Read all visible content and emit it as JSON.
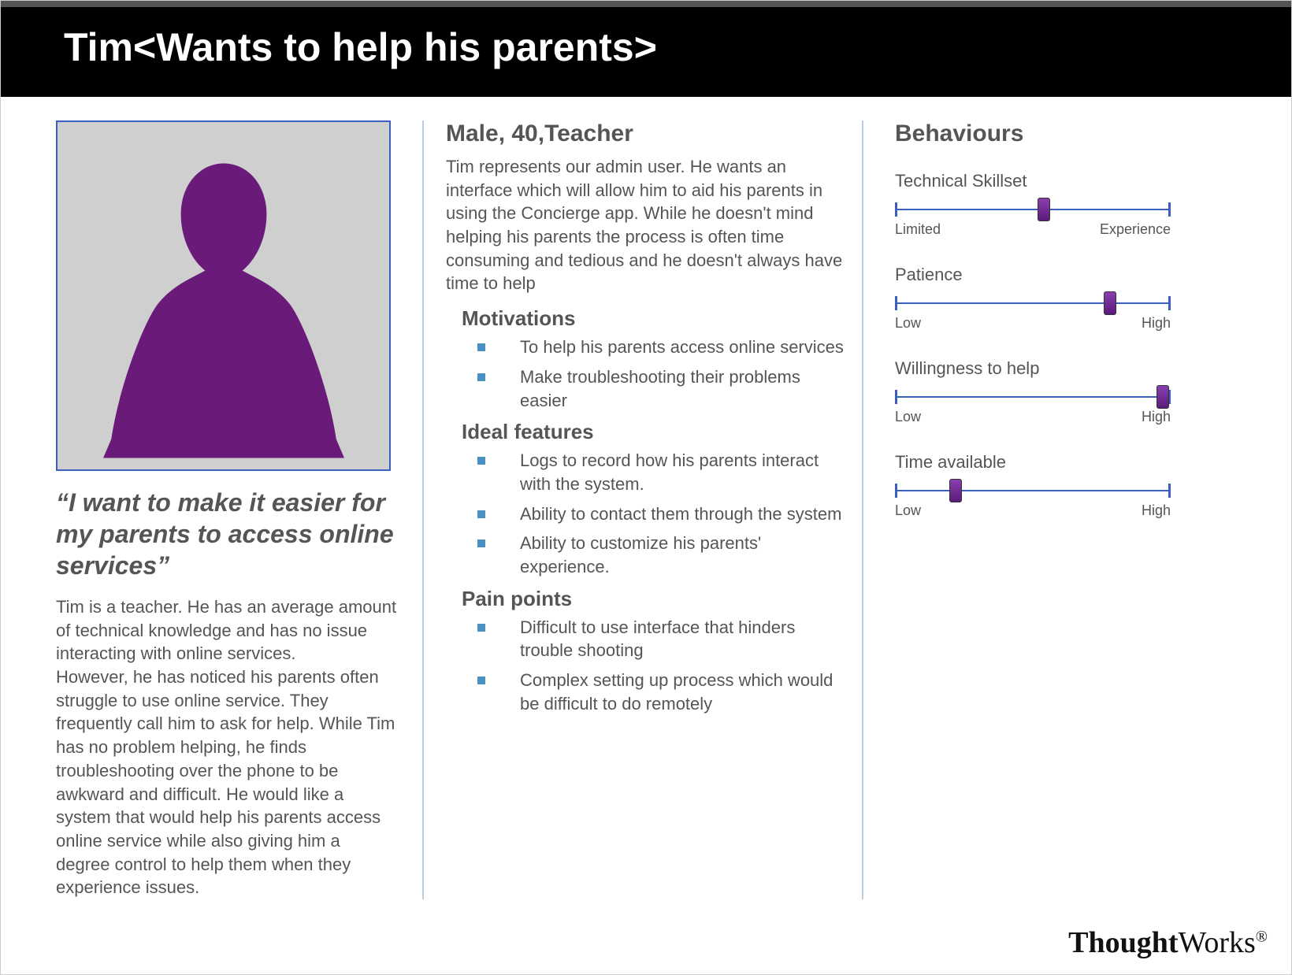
{
  "header": {
    "title": "Tim<Wants to help his parents>"
  },
  "left": {
    "quote": "“I want to make it easier for my parents to access online services”",
    "bio1": "Tim is a teacher. He has an average amount of technical knowledge and has no issue interacting with online services.",
    "bio2": "However, he has noticed his parents often struggle to use online service. They frequently call him to ask for help. While Tim has no problem helping, he finds troubleshooting over the phone to be awkward and difficult. He would like a system that would help his parents access online service while also giving him a degree control to help them when they experience issues."
  },
  "mid": {
    "demographics": "Male, 40,Teacher",
    "description": " Tim represents our admin user. He wants an interface which will allow him to aid his parents in using the Concierge app. While he doesn't mind  helping his parents the process is often time consuming and tedious and he doesn't always have time to help",
    "motivations_h": "Motivations",
    "motivations": [
      "To help his parents access online services",
      "Make troubleshooting their problems easier"
    ],
    "ideal_h": "Ideal features",
    "ideal": [
      "Logs to record how his parents interact with the system.",
      "Ability to contact them through the system",
      "Ability to customize his parents' experience."
    ],
    "pain_h": "Pain points",
    "pain": [
      "Difficult to use interface that hinders trouble shooting",
      "Complex setting up process which would be difficult to do remotely"
    ]
  },
  "right": {
    "title": "Behaviours",
    "scales": [
      {
        "label": "Technical Skillset",
        "low": "Limited",
        "high": "Experience",
        "value": 54
      },
      {
        "label": "Patience",
        "low": "Low",
        "high": "High",
        "value": 78
      },
      {
        "label": "Willingness to help",
        "low": "Low",
        "high": "High",
        "value": 97
      },
      {
        "label": "Time available",
        "low": "Low",
        "high": "High",
        "value": 22
      }
    ]
  },
  "footer": {
    "logo_bold": "Thought",
    "logo_rest": "Works",
    "reg": "®"
  }
}
